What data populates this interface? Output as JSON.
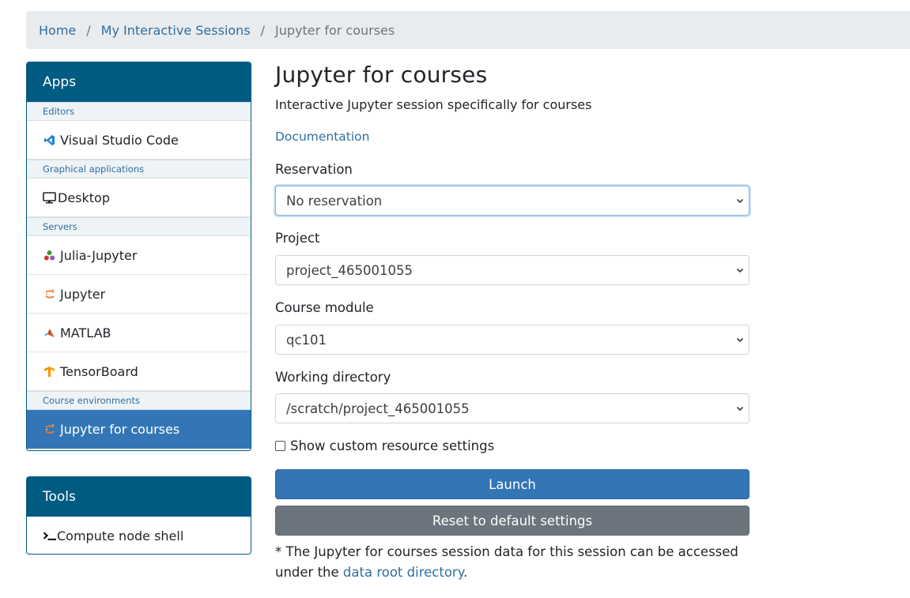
{
  "breadcrumb": {
    "home": "Home",
    "sessions": "My Interactive Sessions",
    "current": "Jupyter for courses",
    "separator": "/"
  },
  "sidebar": {
    "apps_header": "Apps",
    "groups": {
      "editors": "Editors",
      "graphical": "Graphical applications",
      "servers": "Servers",
      "courses": "Course environments"
    },
    "items": {
      "vscode": "Visual Studio Code",
      "desktop": "Desktop",
      "julia": "Julia-Jupyter",
      "jupyter": "Jupyter",
      "matlab": "MATLAB",
      "tensorboard": "TensorBoard",
      "jupyter_courses": "Jupyter for courses"
    },
    "tools_header": "Tools",
    "tools_items": {
      "shell": "Compute node shell"
    }
  },
  "main": {
    "title": "Jupyter for courses",
    "subtitle": "Interactive Jupyter session specifically for courses",
    "documentation": "Documentation",
    "reservation_label": "Reservation",
    "reservation_value": "No reservation",
    "project_label": "Project",
    "project_value": "project_465001055",
    "module_label": "Course module",
    "module_value": "qc101",
    "workdir_label": "Working directory",
    "workdir_value": "/scratch/project_465001055",
    "custom_settings_label": "Show custom resource settings",
    "launch_label": "Launch",
    "reset_label": "Reset to default settings",
    "note_prefix": "* The Jupyter for courses session data for this session can be accessed under the ",
    "note_link": "data root directory",
    "note_suffix": "."
  },
  "colors": {
    "header_blue": "#005b82",
    "active_blue": "#3476b5",
    "link_blue": "#2f6f9f",
    "reset_gray": "#6c757d"
  },
  "icons": {
    "vscode": "vscode-icon",
    "desktop": "desktop-icon",
    "julia": "julia-icon",
    "jupyter": "jupyter-icon",
    "matlab": "matlab-icon",
    "tensorboard": "tensorboard-icon",
    "shell": "terminal-icon"
  }
}
